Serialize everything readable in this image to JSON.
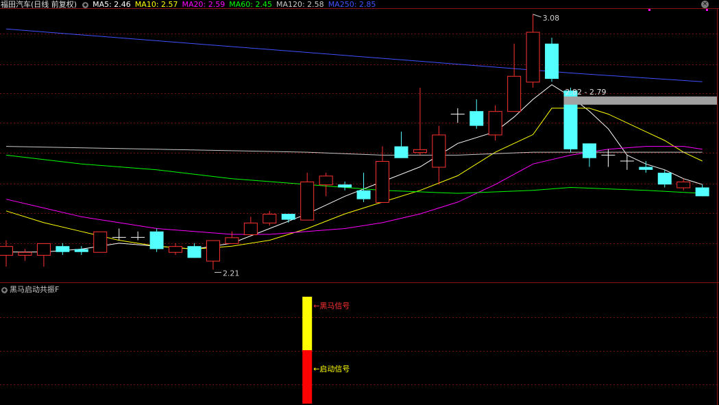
{
  "header": {
    "title": "福田汽车(日线 前复权)",
    "ma_items": [
      {
        "label": "MA5: 2.46",
        "color": "#ffffff"
      },
      {
        "label": "MA10: 2.57",
        "color": "#ffff00"
      },
      {
        "label": "MA20: 2.59",
        "color": "#ff00ff"
      },
      {
        "label": "MA60: 2.45",
        "color": "#00ff00"
      },
      {
        "label": "MA120: 2.58",
        "color": "#c8c8c8"
      },
      {
        "label": "MA250: 2.85",
        "color": "#3f52ff"
      }
    ]
  },
  "indicator": {
    "name": "黑马启动共振F",
    "signal_top_label": "黑马信号",
    "signal_bottom_label": "启动信号"
  },
  "chart_data": {
    "type": "candlestick",
    "annotations": {
      "high": "3.08",
      "low": "2.21",
      "range": "2.82 - 2.79"
    },
    "candles": [
      {
        "o": 2.26,
        "c": 2.29,
        "h": 2.31,
        "l": 2.22
      },
      {
        "o": 2.26,
        "c": 2.27,
        "h": 2.28,
        "l": 2.24
      },
      {
        "o": 2.26,
        "c": 2.3,
        "h": 2.3,
        "l": 2.22
      },
      {
        "o": 2.29,
        "c": 2.27,
        "h": 2.3,
        "l": 2.26
      },
      {
        "o": 2.28,
        "c": 2.27,
        "h": 2.29,
        "l": 2.26
      },
      {
        "o": 2.27,
        "c": 2.34,
        "h": 2.34,
        "l": 2.27
      },
      {
        "o": 2.32,
        "c": 2.32,
        "h": 2.35,
        "l": 2.31
      },
      {
        "o": 2.32,
        "c": 2.32,
        "h": 2.34,
        "l": 2.31
      },
      {
        "o": 2.34,
        "c": 2.28,
        "h": 2.35,
        "l": 2.27
      },
      {
        "o": 2.27,
        "c": 2.29,
        "h": 2.3,
        "l": 2.26
      },
      {
        "o": 2.29,
        "c": 2.25,
        "h": 2.3,
        "l": 2.25
      },
      {
        "o": 2.24,
        "c": 2.31,
        "h": 2.31,
        "l": 2.21
      },
      {
        "o": 2.3,
        "c": 2.32,
        "h": 2.34,
        "l": 2.3
      },
      {
        "o": 2.33,
        "c": 2.37,
        "h": 2.39,
        "l": 2.33
      },
      {
        "o": 2.37,
        "c": 2.4,
        "h": 2.41,
        "l": 2.36
      },
      {
        "o": 2.4,
        "c": 2.38,
        "h": 2.4,
        "l": 2.37
      },
      {
        "o": 2.38,
        "c": 2.51,
        "h": 2.54,
        "l": 2.38
      },
      {
        "o": 2.5,
        "c": 2.53,
        "h": 2.54,
        "l": 2.46
      },
      {
        "o": 2.5,
        "c": 2.49,
        "h": 2.51,
        "l": 2.48
      },
      {
        "o": 2.48,
        "c": 2.45,
        "h": 2.54,
        "l": 2.44
      },
      {
        "o": 2.44,
        "c": 2.58,
        "h": 2.63,
        "l": 2.44
      },
      {
        "o": 2.63,
        "c": 2.59,
        "h": 2.68,
        "l": 2.59
      },
      {
        "o": 2.61,
        "c": 2.62,
        "h": 2.83,
        "l": 2.6
      },
      {
        "o": 2.56,
        "c": 2.67,
        "h": 2.7,
        "l": 2.5
      },
      {
        "o": 2.74,
        "c": 2.74,
        "h": 2.76,
        "l": 2.71
      },
      {
        "o": 2.75,
        "c": 2.7,
        "h": 2.79,
        "l": 2.69
      },
      {
        "o": 2.67,
        "c": 2.75,
        "h": 2.77,
        "l": 2.65
      },
      {
        "o": 2.75,
        "c": 2.87,
        "h": 2.98,
        "l": 2.75
      },
      {
        "o": 2.85,
        "c": 3.02,
        "h": 3.08,
        "l": 2.83
      },
      {
        "o": 2.98,
        "c": 2.86,
        "h": 3.0,
        "l": 2.85
      },
      {
        "o": 2.82,
        "c": 2.62,
        "h": 2.83,
        "l": 2.61
      },
      {
        "o": 2.64,
        "c": 2.59,
        "h": 2.64,
        "l": 2.56
      },
      {
        "o": 2.6,
        "c": 2.6,
        "h": 2.62,
        "l": 2.56
      },
      {
        "o": 2.58,
        "c": 2.58,
        "h": 2.6,
        "l": 2.55
      },
      {
        "o": 2.56,
        "c": 2.55,
        "h": 2.58,
        "l": 2.54
      },
      {
        "o": 2.54,
        "c": 2.5,
        "h": 2.55,
        "l": 2.49
      },
      {
        "o": 2.49,
        "c": 2.51,
        "h": 2.52,
        "l": 2.48
      },
      {
        "o": 2.49,
        "c": 2.46,
        "h": 2.5,
        "l": 2.46
      }
    ],
    "ma": [
      {
        "name": "MA5",
        "color": "#ffffff",
        "points": [
          [
            0,
            2.27
          ],
          [
            2,
            2.27
          ],
          [
            4,
            2.28
          ],
          [
            6,
            2.3
          ],
          [
            8,
            2.29
          ],
          [
            10,
            2.28
          ],
          [
            12,
            2.3
          ],
          [
            14,
            2.35
          ],
          [
            16,
            2.4
          ],
          [
            18,
            2.46
          ],
          [
            20,
            2.51
          ],
          [
            22,
            2.56
          ],
          [
            24,
            2.64
          ],
          [
            26,
            2.68
          ],
          [
            27,
            2.73
          ],
          [
            28,
            2.79
          ],
          [
            29,
            2.84
          ],
          [
            30,
            2.8
          ],
          [
            31,
            2.75
          ],
          [
            32,
            2.69
          ],
          [
            33,
            2.6
          ],
          [
            34,
            2.57
          ],
          [
            35,
            2.55
          ],
          [
            36,
            2.52
          ],
          [
            37,
            2.5
          ]
        ]
      },
      {
        "name": "MA10",
        "color": "#ffff00",
        "points": [
          [
            0,
            2.41
          ],
          [
            2,
            2.37
          ],
          [
            4,
            2.34
          ],
          [
            6,
            2.31
          ],
          [
            8,
            2.29
          ],
          [
            10,
            2.28
          ],
          [
            12,
            2.29
          ],
          [
            14,
            2.31
          ],
          [
            16,
            2.35
          ],
          [
            18,
            2.4
          ],
          [
            20,
            2.44
          ],
          [
            22,
            2.48
          ],
          [
            24,
            2.53
          ],
          [
            26,
            2.61
          ],
          [
            28,
            2.67
          ],
          [
            29,
            2.76
          ],
          [
            30,
            2.76
          ],
          [
            31,
            2.76
          ],
          [
            32,
            2.74
          ],
          [
            33,
            2.71
          ],
          [
            34,
            2.68
          ],
          [
            35,
            2.65
          ],
          [
            36,
            2.61
          ],
          [
            37,
            2.58
          ]
        ]
      },
      {
        "name": "MA20",
        "color": "#ff00ff",
        "points": [
          [
            0,
            2.45
          ],
          [
            2,
            2.42
          ],
          [
            4,
            2.39
          ],
          [
            6,
            2.37
          ],
          [
            8,
            2.35
          ],
          [
            10,
            2.34
          ],
          [
            12,
            2.33
          ],
          [
            14,
            2.33
          ],
          [
            16,
            2.34
          ],
          [
            18,
            2.35
          ],
          [
            20,
            2.37
          ],
          [
            22,
            2.4
          ],
          [
            24,
            2.44
          ],
          [
            26,
            2.5
          ],
          [
            28,
            2.57
          ],
          [
            30,
            2.6
          ],
          [
            32,
            2.62
          ],
          [
            34,
            2.63
          ],
          [
            36,
            2.63
          ],
          [
            37,
            2.62
          ]
        ]
      },
      {
        "name": "MA60",
        "color": "#00ff00",
        "points": [
          [
            0,
            2.6
          ],
          [
            4,
            2.57
          ],
          [
            8,
            2.55
          ],
          [
            12,
            2.52
          ],
          [
            16,
            2.5
          ],
          [
            20,
            2.48
          ],
          [
            24,
            2.47
          ],
          [
            28,
            2.48
          ],
          [
            30,
            2.49
          ],
          [
            34,
            2.48
          ],
          [
            37,
            2.47
          ]
        ]
      },
      {
        "name": "MA120",
        "color": "#c8c8c8",
        "points": [
          [
            0,
            2.63
          ],
          [
            8,
            2.62
          ],
          [
            16,
            2.61
          ],
          [
            20,
            2.6
          ],
          [
            24,
            2.6
          ],
          [
            28,
            2.61
          ],
          [
            30,
            2.61
          ],
          [
            34,
            2.61
          ],
          [
            37,
            2.61
          ]
        ]
      },
      {
        "name": "MA250",
        "color": "#3f52ff",
        "points": [
          [
            0,
            3.03
          ],
          [
            10,
            2.98
          ],
          [
            20,
            2.93
          ],
          [
            30,
            2.88
          ],
          [
            37,
            2.85
          ]
        ]
      }
    ],
    "signals": [
      {
        "index": 16,
        "segments": [
          {
            "name": "黑马信号",
            "color": "#ffff00",
            "from": 1.0,
            "to": 0.5
          },
          {
            "name": "启动信号",
            "color": "#ff0000",
            "from": 0.5,
            "to": 0.0
          }
        ]
      }
    ],
    "ylim": [
      2.19,
      3.11
    ]
  }
}
